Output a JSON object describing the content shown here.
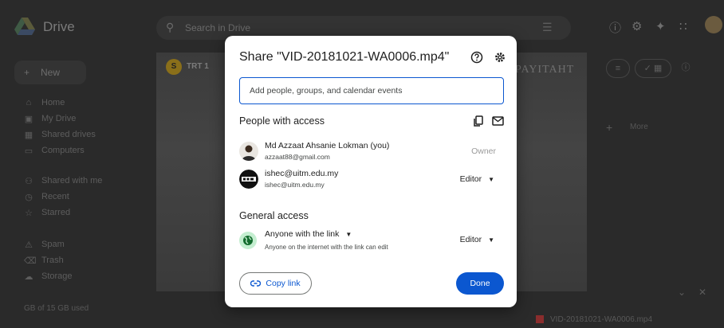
{
  "app": {
    "name": "Drive",
    "search_placeholder": "Search in Drive",
    "new_label": "New",
    "nav": [
      {
        "label": "Home",
        "icon": "home-icon"
      },
      {
        "label": "My Drive",
        "icon": "drive-icon"
      },
      {
        "label": "Shared drives",
        "icon": "shared-drives-icon"
      },
      {
        "label": "Computers",
        "icon": "computer-icon"
      },
      {
        "label": "Shared with me",
        "icon": "people-icon"
      },
      {
        "label": "Recent",
        "icon": "clock-icon"
      },
      {
        "label": "Starred",
        "icon": "star-icon"
      },
      {
        "label": "Spam",
        "icon": "spam-icon"
      },
      {
        "label": "Trash",
        "icon": "trash-icon"
      },
      {
        "label": "Storage",
        "icon": "cloud-icon"
      }
    ],
    "storage_text": "GB of 15 GB used",
    "preview_channel": "TRT 1",
    "preview_title": "PAYITAHT",
    "toolbar_more": "More",
    "bottom_file": "VID-20181021-WA0006.mp4"
  },
  "dialog": {
    "title": "Share \"VID-20181021-WA0006.mp4\"",
    "input_placeholder": "Add people, groups, and calendar events",
    "people_section": "People with access",
    "people": [
      {
        "name": "Md Azzaat Ahsanie Lokman (you)",
        "email": "azzaat88@gmail.com",
        "role": "Owner"
      },
      {
        "name": "ishec@uitm.edu.my",
        "email": "ishec@uitm.edu.my",
        "role": "Editor"
      }
    ],
    "general_section": "General access",
    "access_scope": "Anyone with the link",
    "access_desc": "Anyone on the internet with the link can edit",
    "access_role": "Editor",
    "copy_link_label": "Copy link",
    "done_label": "Done"
  },
  "colors": {
    "accent": "#0b57d0",
    "globe_bg": "#c4eed0",
    "globe_fg": "#146c2e"
  }
}
